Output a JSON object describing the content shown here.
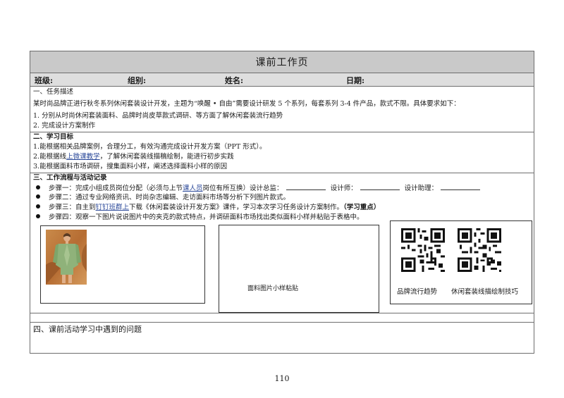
{
  "header": {
    "title": "课前工作页"
  },
  "info_row": {
    "class_label": "班级:",
    "group_label": "组别:",
    "name_label": "姓名:",
    "date_label": "日期:"
  },
  "section1": {
    "heading": "一、任务描述",
    "intro": "某时尚品牌正进行秋冬系列休闲套装设计开发，主题为“唤醒 • 自由”需要设计研发 5 个系列，每套系列 3-4 件产品，款式不限。具体要求如下：",
    "items": [
      "1.  分别从时尚休闲套装面料、品牌时尚皮草款式调研、等方面了解休闲套装流行趋势",
      "2.  完成设计方案制作"
    ]
  },
  "section2": {
    "heading": "二、学习目标",
    "goal1": "1.能根据相关品牌案例，合理分工，有效沟通完成设计开发方案（PPT 形式）。",
    "goal2_pre": "2.能根据线",
    "goal2_link": "上微课教学",
    "goal2_post": "，了解休闲套装线描稿绘制，能进行初步实践",
    "goal3": "3.能根据面料市场调研，搜集面料小样，阐述选择面料小样的原因"
  },
  "section3": {
    "heading": "三、工作流程与活动记录",
    "step1_pre": "步骤一：完成小组成员岗位分配（必须与上节",
    "step1_link": "课人员",
    "step1_post": "岗位有所互换）设计总监：",
    "step1_designer": "设计师：",
    "step1_assistant": "设计助理：",
    "step2": "步骤二：通过专业网络资讯、时尚杂志编辑、走访面料市场等分析下列图片款式。",
    "step3_pre": "步骤三：自主到",
    "step3_link": "钉钉班群上",
    "step3_mid": "下载《休闲套装设计开发方案》课件，学习本次学习任务设计方案制作。",
    "step3_bold": "（学习重点）",
    "step4": "步骤四：观察一下图片说说图片中的夹克的款式特点，并调研面料市场找出类似面料小样并粘贴于表格中。",
    "fabric_paste_label": "面料图片小样粘贴",
    "qr1_label": "品牌流行趋势",
    "qr2_label": "休闲套装线描绘制技巧"
  },
  "section4": {
    "heading": "四、课前活动学习中遇到的问题"
  },
  "footer": {
    "page_number": "110"
  },
  "colors": {
    "title_bg": "#c9c9c9",
    "info_bg": "#dedede",
    "link": "#2c4a9a"
  },
  "icons": [
    "qr-code-icon",
    "bullet-icon"
  ]
}
